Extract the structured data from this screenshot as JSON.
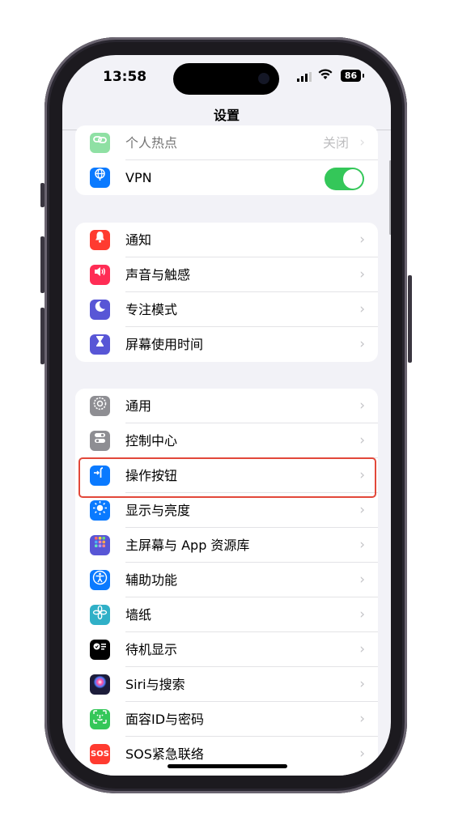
{
  "status_bar": {
    "time": "13:58",
    "battery": "86",
    "wifi_icon": "wifi-icon",
    "signal_icon": "cellular-signal-icon"
  },
  "nav": {
    "title": "设置"
  },
  "group1": {
    "items": [
      {
        "label": "个人热点",
        "value": "关闭",
        "icon": "link-icon",
        "color": "#34c759"
      },
      {
        "label": "VPN",
        "icon": "globe-icon",
        "color": "#0a7aff",
        "toggle_on": true
      }
    ]
  },
  "group2": {
    "items": [
      {
        "label": "通知",
        "icon": "bell-icon",
        "color": "#ff3b30"
      },
      {
        "label": "声音与触感",
        "icon": "speaker-icon",
        "color": "#ff2d55"
      },
      {
        "label": "专注模式",
        "icon": "moon-icon",
        "color": "#5856d6"
      },
      {
        "label": "屏幕使用时间",
        "icon": "hourglass-icon",
        "color": "#5856d6"
      }
    ]
  },
  "group3": {
    "items": [
      {
        "label": "通用",
        "icon": "gear-icon",
        "color": "#8e8e93"
      },
      {
        "label": "控制中心",
        "icon": "switches-icon",
        "color": "#8e8e93"
      },
      {
        "label": "操作按钮",
        "icon": "action-button-icon",
        "color": "#0a7aff",
        "highlighted": true
      },
      {
        "label": "显示与亮度",
        "icon": "sun-icon",
        "color": "#0a7aff"
      },
      {
        "label": "主屏幕与 App 资源库",
        "icon": "home-grid-icon",
        "color": "#5856d6"
      },
      {
        "label": "辅助功能",
        "icon": "accessibility-icon",
        "color": "#0a7aff"
      },
      {
        "label": "墙纸",
        "icon": "flower-icon",
        "color": "#30b0c7"
      },
      {
        "label": "待机显示",
        "icon": "standby-icon",
        "color": "#000000"
      },
      {
        "label": "Siri与搜索",
        "icon": "siri-icon",
        "color": "#1c1c3a"
      },
      {
        "label": "面容ID与密码",
        "icon": "face-id-icon",
        "color": "#34c759"
      },
      {
        "label": "SOS紧急联络",
        "icon": "sos-icon",
        "color": "#ff3b30",
        "icon_text": "SOS"
      }
    ]
  },
  "highlight_color": "#e2483a"
}
